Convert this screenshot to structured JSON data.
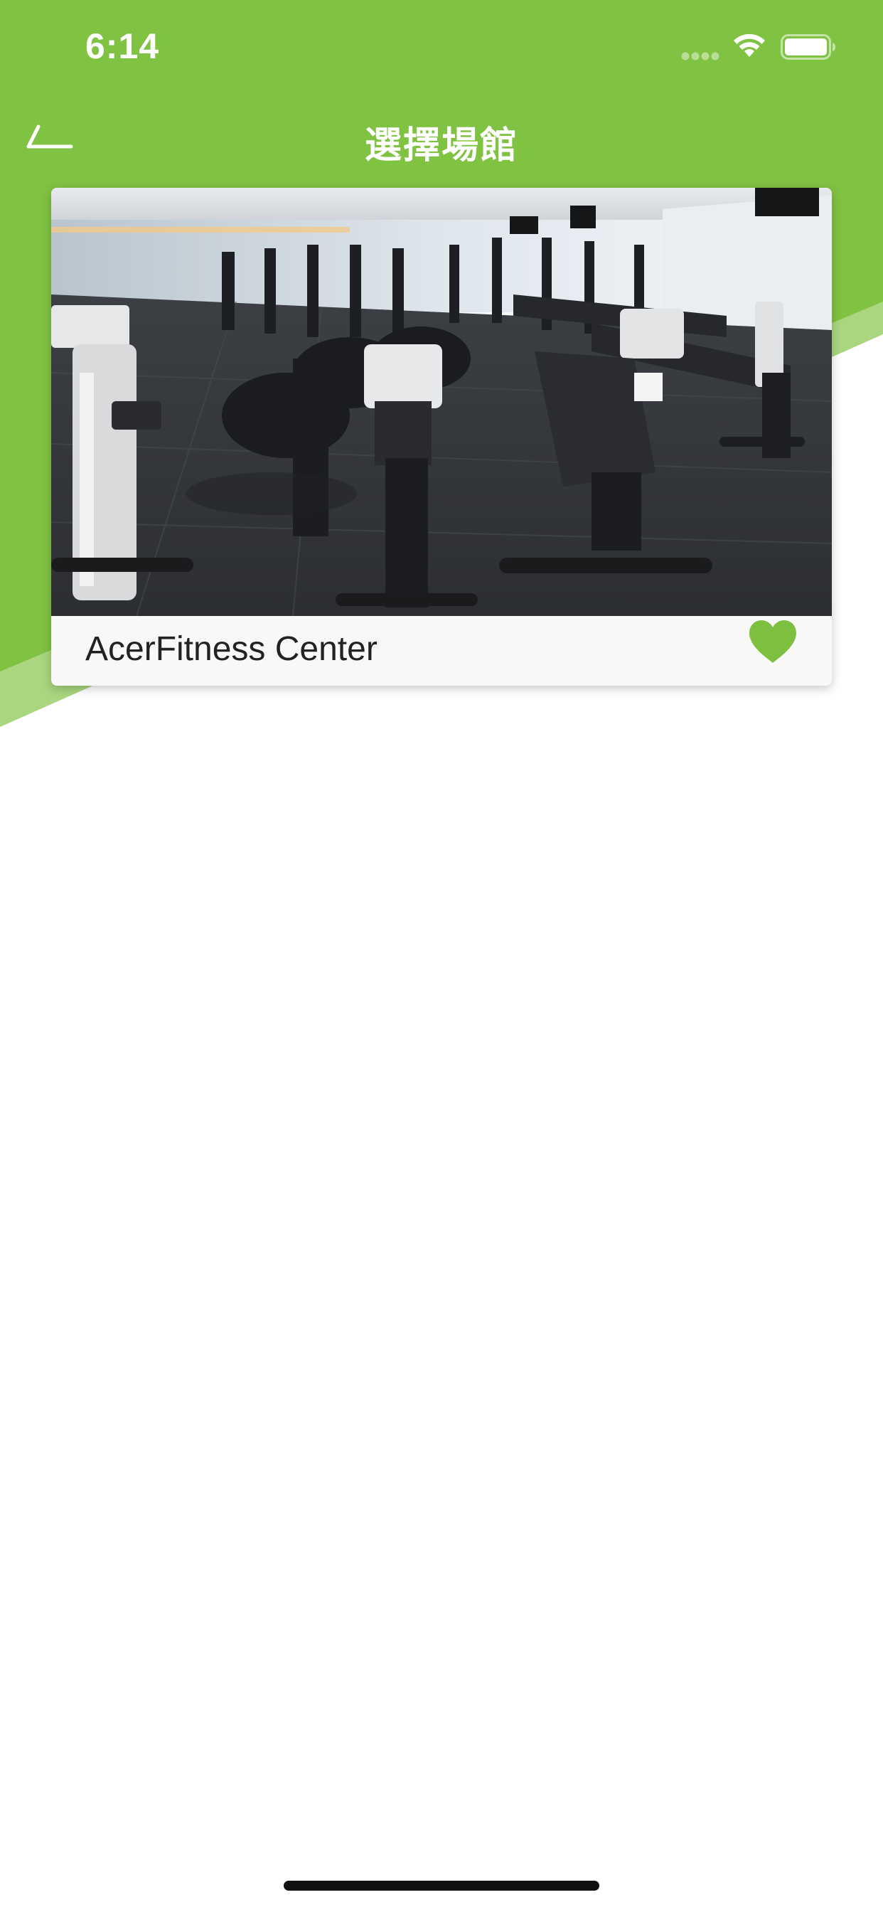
{
  "status_bar": {
    "time": "6:14",
    "icons": [
      "cellular-dots-icon",
      "wifi-icon",
      "battery-icon"
    ]
  },
  "nav": {
    "back_icon": "back-arrow-icon",
    "title": "選擇場館"
  },
  "venues": [
    {
      "name": "AcerFitness Center",
      "photo": "gym-floor-with-exercise-bikes",
      "favorite": true,
      "favorite_icon": "heart-icon"
    }
  ],
  "colors": {
    "brand_green": "#80c242",
    "light_green": "#a9d67f",
    "heart_green": "#7dbf3f"
  }
}
